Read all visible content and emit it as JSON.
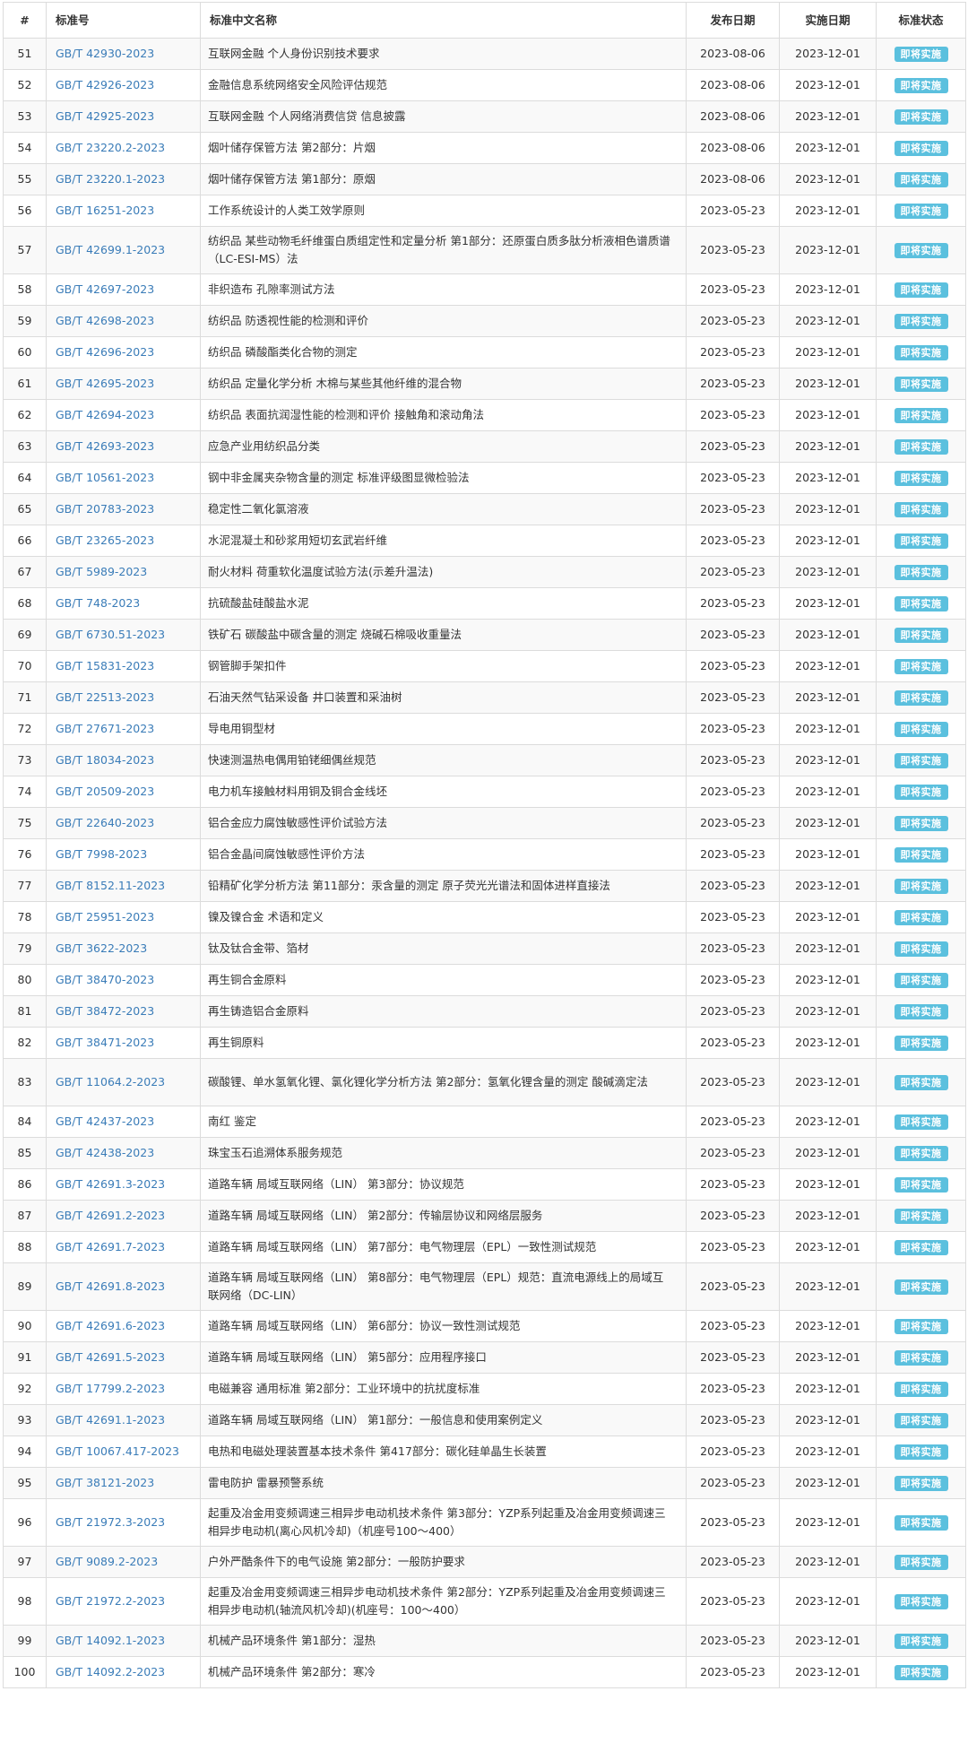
{
  "table": {
    "headers": {
      "num": "#",
      "code": "标准号",
      "name": "标准中文名称",
      "published": "发布日期",
      "implemented": "实施日期",
      "status": "标准状态"
    },
    "rows": [
      {
        "num": "51",
        "code": "GB/T 42930-2023",
        "name": "互联网金融 个人身份识别技术要求",
        "published": "2023-08-06",
        "implemented": "2023-12-01",
        "status": "即将实施"
      },
      {
        "num": "52",
        "code": "GB/T 42926-2023",
        "name": "金融信息系统网络安全风险评估规范",
        "published": "2023-08-06",
        "implemented": "2023-12-01",
        "status": "即将实施"
      },
      {
        "num": "53",
        "code": "GB/T 42925-2023",
        "name": "互联网金融 个人网络消费信贷 信息披露",
        "published": "2023-08-06",
        "implemented": "2023-12-01",
        "status": "即将实施"
      },
      {
        "num": "54",
        "code": "GB/T 23220.2-2023",
        "name": "烟叶储存保管方法 第2部分：片烟",
        "published": "2023-08-06",
        "implemented": "2023-12-01",
        "status": "即将实施"
      },
      {
        "num": "55",
        "code": "GB/T 23220.1-2023",
        "name": "烟叶储存保管方法 第1部分：原烟",
        "published": "2023-08-06",
        "implemented": "2023-12-01",
        "status": "即将实施"
      },
      {
        "num": "56",
        "code": "GB/T 16251-2023",
        "name": "工作系统设计的人类工效学原则",
        "published": "2023-05-23",
        "implemented": "2023-12-01",
        "status": "即将实施"
      },
      {
        "num": "57",
        "code": "GB/T 42699.1-2023",
        "name": "纺织品 某些动物毛纤维蛋白质组定性和定量分析 第1部分：还原蛋白质多肽分析液相色谱质谱（LC-ESI-MS）法",
        "published": "2023-05-23",
        "implemented": "2023-12-01",
        "status": "即将实施"
      },
      {
        "num": "58",
        "code": "GB/T 42697-2023",
        "name": "非织造布 孔隙率测试方法",
        "published": "2023-05-23",
        "implemented": "2023-12-01",
        "status": "即将实施"
      },
      {
        "num": "59",
        "code": "GB/T 42698-2023",
        "name": "纺织品 防透视性能的检测和评价",
        "published": "2023-05-23",
        "implemented": "2023-12-01",
        "status": "即将实施"
      },
      {
        "num": "60",
        "code": "GB/T 42696-2023",
        "name": "纺织品 磷酸酯类化合物的测定",
        "published": "2023-05-23",
        "implemented": "2023-12-01",
        "status": "即将实施"
      },
      {
        "num": "61",
        "code": "GB/T 42695-2023",
        "name": "纺织品 定量化学分析 木棉与某些其他纤维的混合物",
        "published": "2023-05-23",
        "implemented": "2023-12-01",
        "status": "即将实施"
      },
      {
        "num": "62",
        "code": "GB/T 42694-2023",
        "name": "纺织品 表面抗润湿性能的检测和评价 接触角和滚动角法",
        "published": "2023-05-23",
        "implemented": "2023-12-01",
        "status": "即将实施"
      },
      {
        "num": "63",
        "code": "GB/T 42693-2023",
        "name": "应急产业用纺织品分类",
        "published": "2023-05-23",
        "implemented": "2023-12-01",
        "status": "即将实施"
      },
      {
        "num": "64",
        "code": "GB/T 10561-2023",
        "name": "钢中非金属夹杂物含量的测定 标准评级图显微检验法",
        "published": "2023-05-23",
        "implemented": "2023-12-01",
        "status": "即将实施"
      },
      {
        "num": "65",
        "code": "GB/T 20783-2023",
        "name": "稳定性二氧化氯溶液",
        "published": "2023-05-23",
        "implemented": "2023-12-01",
        "status": "即将实施"
      },
      {
        "num": "66",
        "code": "GB/T 23265-2023",
        "name": "水泥混凝土和砂浆用短切玄武岩纤维",
        "published": "2023-05-23",
        "implemented": "2023-12-01",
        "status": "即将实施"
      },
      {
        "num": "67",
        "code": "GB/T 5989-2023",
        "name": "耐火材料 荷重软化温度试验方法(示差升温法)",
        "published": "2023-05-23",
        "implemented": "2023-12-01",
        "status": "即将实施"
      },
      {
        "num": "68",
        "code": "GB/T 748-2023",
        "name": "抗硫酸盐硅酸盐水泥",
        "published": "2023-05-23",
        "implemented": "2023-12-01",
        "status": "即将实施"
      },
      {
        "num": "69",
        "code": "GB/T 6730.51-2023",
        "name": "铁矿石 碳酸盐中碳含量的测定 烧碱石棉吸收重量法",
        "published": "2023-05-23",
        "implemented": "2023-12-01",
        "status": "即将实施"
      },
      {
        "num": "70",
        "code": "GB/T 15831-2023",
        "name": "钢管脚手架扣件",
        "published": "2023-05-23",
        "implemented": "2023-12-01",
        "status": "即将实施"
      },
      {
        "num": "71",
        "code": "GB/T 22513-2023",
        "name": "石油天然气钻采设备 井口装置和采油树",
        "published": "2023-05-23",
        "implemented": "2023-12-01",
        "status": "即将实施"
      },
      {
        "num": "72",
        "code": "GB/T 27671-2023",
        "name": "导电用铜型材",
        "published": "2023-05-23",
        "implemented": "2023-12-01",
        "status": "即将实施"
      },
      {
        "num": "73",
        "code": "GB/T 18034-2023",
        "name": "快速测温热电偶用铂铑细偶丝规范",
        "published": "2023-05-23",
        "implemented": "2023-12-01",
        "status": "即将实施"
      },
      {
        "num": "74",
        "code": "GB/T 20509-2023",
        "name": "电力机车接触材料用铜及铜合金线坯",
        "published": "2023-05-23",
        "implemented": "2023-12-01",
        "status": "即将实施"
      },
      {
        "num": "75",
        "code": "GB/T 22640-2023",
        "name": "铝合金应力腐蚀敏感性评价试验方法",
        "published": "2023-05-23",
        "implemented": "2023-12-01",
        "status": "即将实施"
      },
      {
        "num": "76",
        "code": "GB/T 7998-2023",
        "name": "铝合金晶间腐蚀敏感性评价方法",
        "published": "2023-05-23",
        "implemented": "2023-12-01",
        "status": "即将实施"
      },
      {
        "num": "77",
        "code": "GB/T 8152.11-2023",
        "name": "铅精矿化学分析方法 第11部分：汞含量的测定 原子荧光光谱法和固体进样直接法",
        "published": "2023-05-23",
        "implemented": "2023-12-01",
        "status": "即将实施"
      },
      {
        "num": "78",
        "code": "GB/T 25951-2023",
        "name": "镍及镍合金 术语和定义",
        "published": "2023-05-23",
        "implemented": "2023-12-01",
        "status": "即将实施"
      },
      {
        "num": "79",
        "code": "GB/T 3622-2023",
        "name": "钛及钛合金带、箔材",
        "published": "2023-05-23",
        "implemented": "2023-12-01",
        "status": "即将实施"
      },
      {
        "num": "80",
        "code": "GB/T 38470-2023",
        "name": "再生铜合金原料",
        "published": "2023-05-23",
        "implemented": "2023-12-01",
        "status": "即将实施"
      },
      {
        "num": "81",
        "code": "GB/T 38472-2023",
        "name": "再生铸造铝合金原料",
        "published": "2023-05-23",
        "implemented": "2023-12-01",
        "status": "即将实施"
      },
      {
        "num": "82",
        "code": "GB/T 38471-2023",
        "name": "再生铜原料",
        "published": "2023-05-23",
        "implemented": "2023-12-01",
        "status": "即将实施"
      },
      {
        "num": "83",
        "code": "GB/T 11064.2-2023",
        "name": "碳酸锂、单水氢氧化锂、氯化锂化学分析方法 第2部分：氢氧化锂含量的测定 酸碱滴定法",
        "published": "2023-05-23",
        "implemented": "2023-12-01",
        "status": "即将实施"
      },
      {
        "num": "84",
        "code": "GB/T 42437-2023",
        "name": "南红 鉴定",
        "published": "2023-05-23",
        "implemented": "2023-12-01",
        "status": "即将实施"
      },
      {
        "num": "85",
        "code": "GB/T 42438-2023",
        "name": "珠宝玉石追溯体系服务规范",
        "published": "2023-05-23",
        "implemented": "2023-12-01",
        "status": "即将实施"
      },
      {
        "num": "86",
        "code": "GB/T 42691.3-2023",
        "name": "道路车辆 局域互联网络（LIN） 第3部分：协议规范",
        "published": "2023-05-23",
        "implemented": "2023-12-01",
        "status": "即将实施"
      },
      {
        "num": "87",
        "code": "GB/T 42691.2-2023",
        "name": "道路车辆 局域互联网络（LIN） 第2部分：传输层协议和网络层服务",
        "published": "2023-05-23",
        "implemented": "2023-12-01",
        "status": "即将实施"
      },
      {
        "num": "88",
        "code": "GB/T 42691.7-2023",
        "name": "道路车辆 局域互联网络（LIN） 第7部分：电气物理层（EPL）一致性测试规范",
        "published": "2023-05-23",
        "implemented": "2023-12-01",
        "status": "即将实施"
      },
      {
        "num": "89",
        "code": "GB/T 42691.8-2023",
        "name": "道路车辆 局域互联网络（LIN） 第8部分：电气物理层（EPL）规范：直流电源线上的局域互联网络（DC-LIN）",
        "published": "2023-05-23",
        "implemented": "2023-12-01",
        "status": "即将实施"
      },
      {
        "num": "90",
        "code": "GB/T 42691.6-2023",
        "name": "道路车辆 局域互联网络（LIN） 第6部分：协议一致性测试规范",
        "published": "2023-05-23",
        "implemented": "2023-12-01",
        "status": "即将实施"
      },
      {
        "num": "91",
        "code": "GB/T 42691.5-2023",
        "name": "道路车辆 局域互联网络（LIN） 第5部分：应用程序接口",
        "published": "2023-05-23",
        "implemented": "2023-12-01",
        "status": "即将实施"
      },
      {
        "num": "92",
        "code": "GB/T 17799.2-2023",
        "name": "电磁兼容 通用标准 第2部分：工业环境中的抗扰度标准",
        "published": "2023-05-23",
        "implemented": "2023-12-01",
        "status": "即将实施"
      },
      {
        "num": "93",
        "code": "GB/T 42691.1-2023",
        "name": "道路车辆 局域互联网络（LIN） 第1部分：一般信息和使用案例定义",
        "published": "2023-05-23",
        "implemented": "2023-12-01",
        "status": "即将实施"
      },
      {
        "num": "94",
        "code": "GB/T 10067.417-2023",
        "name": "电热和电磁处理装置基本技术条件 第417部分：碳化硅单晶生长装置",
        "published": "2023-05-23",
        "implemented": "2023-12-01",
        "status": "即将实施"
      },
      {
        "num": "95",
        "code": "GB/T 38121-2023",
        "name": "雷电防护 雷暴预警系统",
        "published": "2023-05-23",
        "implemented": "2023-12-01",
        "status": "即将实施"
      },
      {
        "num": "96",
        "code": "GB/T 21972.3-2023",
        "name": "起重及冶金用变频调速三相异步电动机技术条件 第3部分：YZP系列起重及冶金用变频调速三相异步电动机(离心风机冷却)（机座号100～400）",
        "published": "2023-05-23",
        "implemented": "2023-12-01",
        "status": "即将实施"
      },
      {
        "num": "97",
        "code": "GB/T 9089.2-2023",
        "name": "户外严酷条件下的电气设施 第2部分：一般防护要求",
        "published": "2023-05-23",
        "implemented": "2023-12-01",
        "status": "即将实施"
      },
      {
        "num": "98",
        "code": "GB/T 21972.2-2023",
        "name": "起重及冶金用变频调速三相异步电动机技术条件 第2部分：YZP系列起重及冶金用变频调速三相异步电动机(轴流风机冷却)(机座号：100～400）",
        "published": "2023-05-23",
        "implemented": "2023-12-01",
        "status": "即将实施"
      },
      {
        "num": "99",
        "code": "GB/T 14092.1-2023",
        "name": "机械产品环境条件 第1部分：湿热",
        "published": "2023-05-23",
        "implemented": "2023-12-01",
        "status": "即将实施"
      },
      {
        "num": "100",
        "code": "GB/T 14092.2-2023",
        "name": "机械产品环境条件 第2部分：寒冷",
        "published": "2023-05-23",
        "implemented": "2023-12-01",
        "status": "即将实施"
      }
    ]
  }
}
